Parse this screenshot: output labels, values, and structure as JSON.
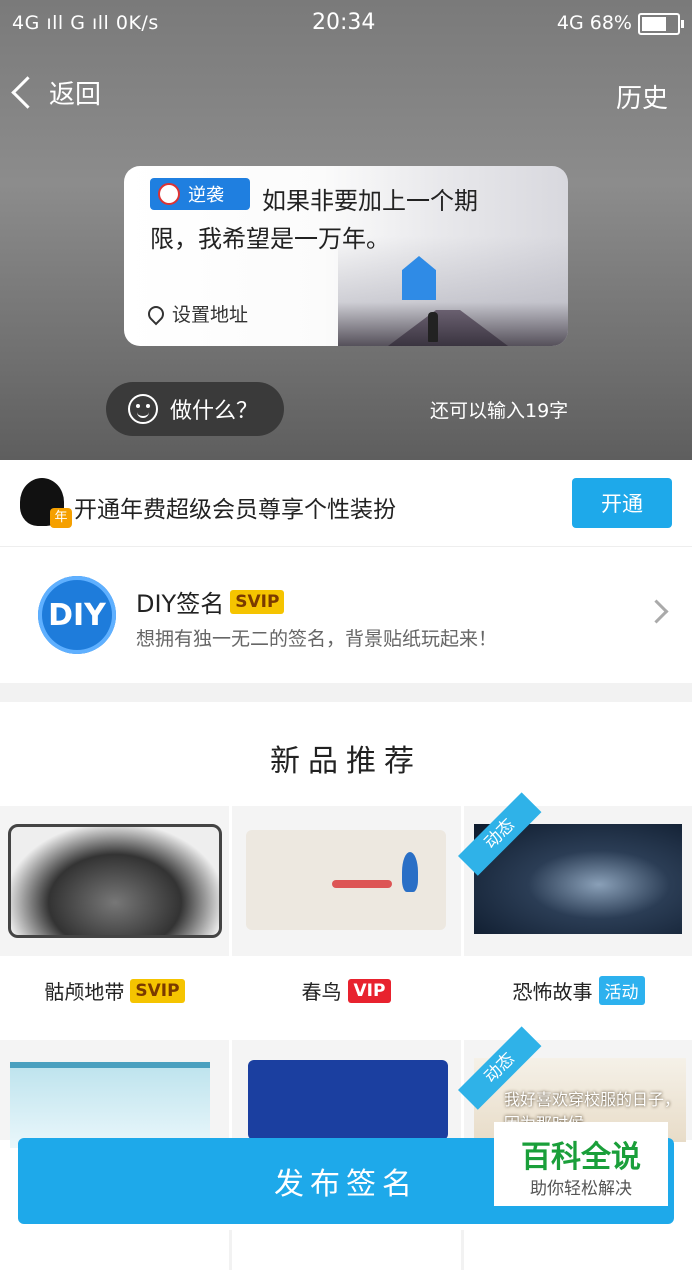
{
  "status_bar": {
    "left": "4G ıll G ıll 0K/s",
    "time": "20:34",
    "right": "4G 68%"
  },
  "nav": {
    "back_label": "返回",
    "history_label": "历史"
  },
  "preview": {
    "badge": "逆袭",
    "text_line1": "如果非要加上一个期",
    "text_line2": "限，我希望是一万年。",
    "location": "设置地址"
  },
  "compose": {
    "doing_label": "做什么？",
    "remaining": "还可以输入19字"
  },
  "promo": {
    "text": "开通年费超级会员尊享个性装扮",
    "button": "开通"
  },
  "diy": {
    "logo_text": "DIY",
    "title": "DIY签名",
    "badge": "SVIP",
    "subtitle": "想拥有独一无二的签名，背景贴纸玩起来！"
  },
  "section_title": "新品推荐",
  "tiles": [
    {
      "name": "骷颅地带",
      "badge": "SVIP",
      "badge_type": "svip",
      "ribbon": ""
    },
    {
      "name": "春鸟",
      "badge": "VIP",
      "badge_type": "vip",
      "ribbon": ""
    },
    {
      "name": "恐怖故事",
      "badge": "活动",
      "badge_type": "act",
      "ribbon": "动态"
    },
    {
      "name": "",
      "badge": "",
      "badge_type": "",
      "ribbon": ""
    },
    {
      "name": "",
      "badge": "",
      "badge_type": "",
      "ribbon": ""
    },
    {
      "name": "",
      "badge": "",
      "badge_type": "",
      "ribbon": "动态",
      "thumb_text": "我好喜欢穿校服的日子，因为那时候"
    }
  ],
  "publish_button": "发布签名",
  "watermark": {
    "title": "百科全说",
    "subtitle": "助你轻松解决"
  },
  "colors": {
    "accent": "#1ea9ea",
    "svip": "#f5c400",
    "vip": "#e8222e"
  }
}
